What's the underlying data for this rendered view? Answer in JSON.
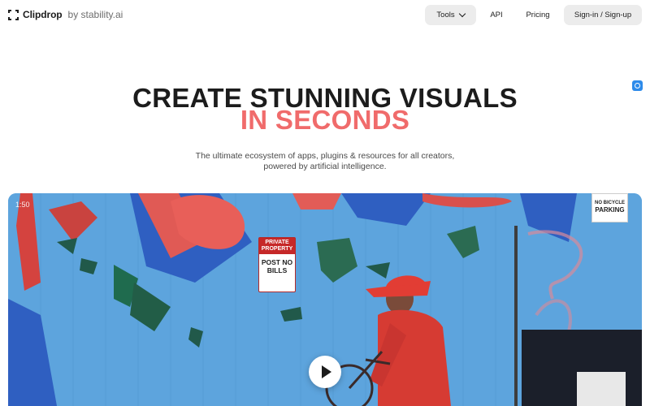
{
  "brand": {
    "name": "Clipdrop",
    "by": "by stability.ai"
  },
  "nav": {
    "tools_label": "Tools",
    "api_label": "API",
    "pricing_label": "Pricing",
    "signin_label": "Sign-in / Sign-up"
  },
  "hero": {
    "title_line1": "CREATE STUNNING VISUALS",
    "title_line2": "IN SECONDS",
    "subtitle_line1": "The ultimate ecosystem of apps, plugins & resources for all creators,",
    "subtitle_line2": "powered by artificial intelligence."
  },
  "video": {
    "time": "1:50",
    "sign_private_top": "PRIVATE PROPERTY",
    "sign_private_bottom": "POST NO BILLS",
    "sign_parking_top": "NO BICYCLE",
    "sign_parking_bottom": "PARKING"
  },
  "colors": {
    "accent": "#f06b6b",
    "text": "#1c1c1c",
    "button_bg": "#ececec",
    "wall_blue": "#5da4dd"
  }
}
